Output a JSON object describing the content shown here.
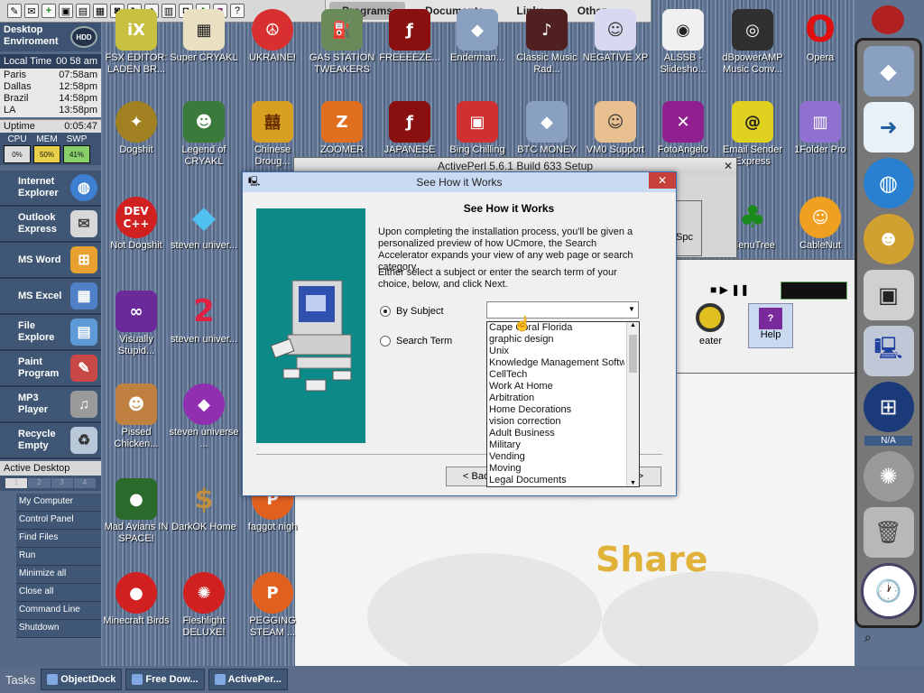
{
  "top_toolbar": {
    "icons": [
      "paint-icon",
      "note-icon",
      "plus-icon",
      "monitor-icon",
      "photo-icon",
      "image-icon",
      "disk-icon",
      "sync-icon",
      "bookmark-icon",
      "folder-icon",
      "camera-icon",
      "tree-icon",
      "book-icon",
      "help-icon"
    ],
    "help_glyph": "?"
  },
  "top_menu": {
    "items": [
      "Programs",
      "Documents",
      "Links",
      "Other"
    ],
    "active": "Programs"
  },
  "left_panel": {
    "header": "Desktop Enviroment",
    "hdd_badge": "HDD",
    "local_time_label": "Local Time",
    "local_time": "00 58 am",
    "clocks": [
      {
        "city": "Paris",
        "time": "07:58am"
      },
      {
        "city": "Dallas",
        "time": "12:58pm"
      },
      {
        "city": "Brazil",
        "time": "14:58pm"
      },
      {
        "city": "LA",
        "time": "13:58pm"
      }
    ],
    "uptime_label": "Uptime",
    "uptime": "0:05:47",
    "meters": [
      {
        "label": "CPU",
        "value": "0%"
      },
      {
        "label": "MEM",
        "value": "50%"
      },
      {
        "label": "SWP",
        "value": "41%"
      }
    ],
    "launchers": [
      "Internet Explorer",
      "Outlook Express",
      "MS Word",
      "MS Excel",
      "File Explore",
      "Paint Program",
      "MP3 Player",
      "Recycle Empty"
    ],
    "active_desktop_label": "Active Desktop",
    "desktop_pages": [
      "1",
      "2",
      "3",
      "4"
    ],
    "commands": [
      "My Computer",
      "Control Panel",
      "Find Files",
      "Run",
      "Minimize all",
      "Close all",
      "Command Line",
      "Shutdown"
    ]
  },
  "desktop_icons": {
    "row1": [
      "FSX EDITOR: LADEN BR...",
      "Super CRYAKL",
      "UKRAINE!",
      "GAS STATION TWEAKERS",
      "FREEEEZE...",
      "Enderman...",
      "Classic Music Rad...",
      "NEGATIVE XP",
      "ALSSB - Slidesho...",
      "dBpowerAMP Music Conv...",
      "Opera"
    ],
    "row2": [
      "Dogshit",
      "Legend of CRYAKL",
      "Chinese Droug...",
      "ZOOMER",
      "JAPANESE",
      "Bing Chilling",
      "BTC MONEY",
      "VM0 Support",
      "FotoAngelo",
      "Email Sender Express",
      "1Folder Pro"
    ],
    "col1": [
      "Not Dogshit",
      "Visually Stupid...",
      "Pissed Chicken...",
      "Mad Avians IN SPACE!",
      "Minecraft Birds"
    ],
    "col2": [
      "steven univer...",
      "steven univer...",
      "steven universe ...",
      "DarkOK Home",
      "Fleshlight DELUXE!"
    ],
    "col3": [
      "faggot nigh",
      "PEGGING STEAM ..."
    ],
    "right_extra": [
      "MenuTree",
      "CableNut"
    ]
  },
  "share_text": "Share",
  "background_windows": {
    "activeperl_title": "ActivePerl 5.6.1 Build 633 Setup",
    "spc_label": "Spc",
    "repeater_label": "eater",
    "help_label": "Help"
  },
  "dialog": {
    "title": "See How it Works",
    "heading": "See How it Works",
    "para1": "Upon completing the installation process, you'll be given a personalized preview of how UCmore, the Search Accelerator expands your view of any web page or search category.",
    "para2": "Either select a subject or enter the search term of your choice, below, and click Next.",
    "radio_subject": "By Subject",
    "radio_term": "Search Term",
    "combo_value": "",
    "dropdown_items": [
      "Cape Coral Florida",
      "graphic design",
      "Unix",
      "Knowledge Management Software",
      "CellTech",
      "Work At Home",
      "Arbitration",
      "Home Decorations",
      "vision correction",
      "Adult Business",
      "Military",
      "Vending",
      "Moving",
      "Legal Documents"
    ],
    "back_button": "< Back",
    "next_button": "Next >"
  },
  "taskbar": {
    "label": "Tasks",
    "tasks": [
      "ObjectDock",
      "Free Dow...",
      "ActivePer..."
    ]
  },
  "right_dock": {
    "na_label": "N/A"
  },
  "colors": {
    "dialog_accent": "#0c8a87",
    "close_red": "#c7413b",
    "share_gold": "#e0b23a"
  }
}
